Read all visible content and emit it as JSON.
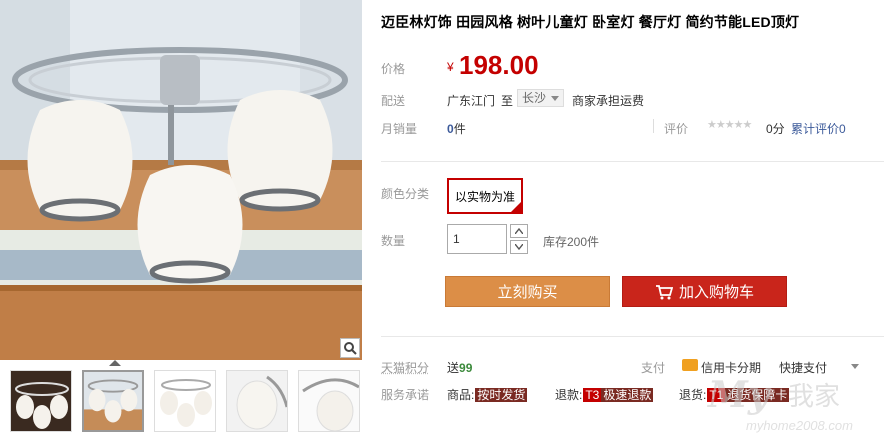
{
  "product": {
    "title": "迈臣林灯饰 田园风格 树叶儿童灯 卧室灯 餐厅灯 简约节能LED顶灯"
  },
  "price": {
    "label": "价格",
    "currency": "¥",
    "value": "198.00"
  },
  "shipping": {
    "label": "配送",
    "from": "广东江门",
    "to_word": "至",
    "city": "长沙",
    "fee_note": "商家承担运费"
  },
  "sales": {
    "label": "月销量",
    "count": "0",
    "unit": "件",
    "rating_label": "评价",
    "stars": "★★★★★",
    "score": "0分",
    "review_link": "累计评价0"
  },
  "options": {
    "color_label": "颜色分类",
    "color_value": "以实物为准",
    "qty_label": "数量",
    "qty_value": "1",
    "stock": "库存200件"
  },
  "buttons": {
    "buy_now": "立刻购买",
    "add_cart": "加入购物车"
  },
  "points": {
    "label": "天猫积分",
    "prefix": "送",
    "value": "99",
    "pay_label": "支付",
    "credit_card": "信用卡分期",
    "quick_pay": "快捷支付"
  },
  "services": {
    "label": "服务承诺",
    "goods_prefix": "商品:",
    "goods_tag": "按时发货",
    "refund_prefix": "退款:",
    "refund_code": "T3",
    "refund_tag": "极速退款",
    "return_prefix": "退货:",
    "return_code": "T1",
    "return_tag": "退货保障卡"
  },
  "watermark": {
    "logo": "My",
    "text": "我家",
    "url": "myhome2008.com"
  },
  "colors": {
    "price_red": "#c40000",
    "buy_orange": "#dc8e47",
    "cart_red": "#c9251b",
    "link_blue": "#3c5a9a"
  }
}
